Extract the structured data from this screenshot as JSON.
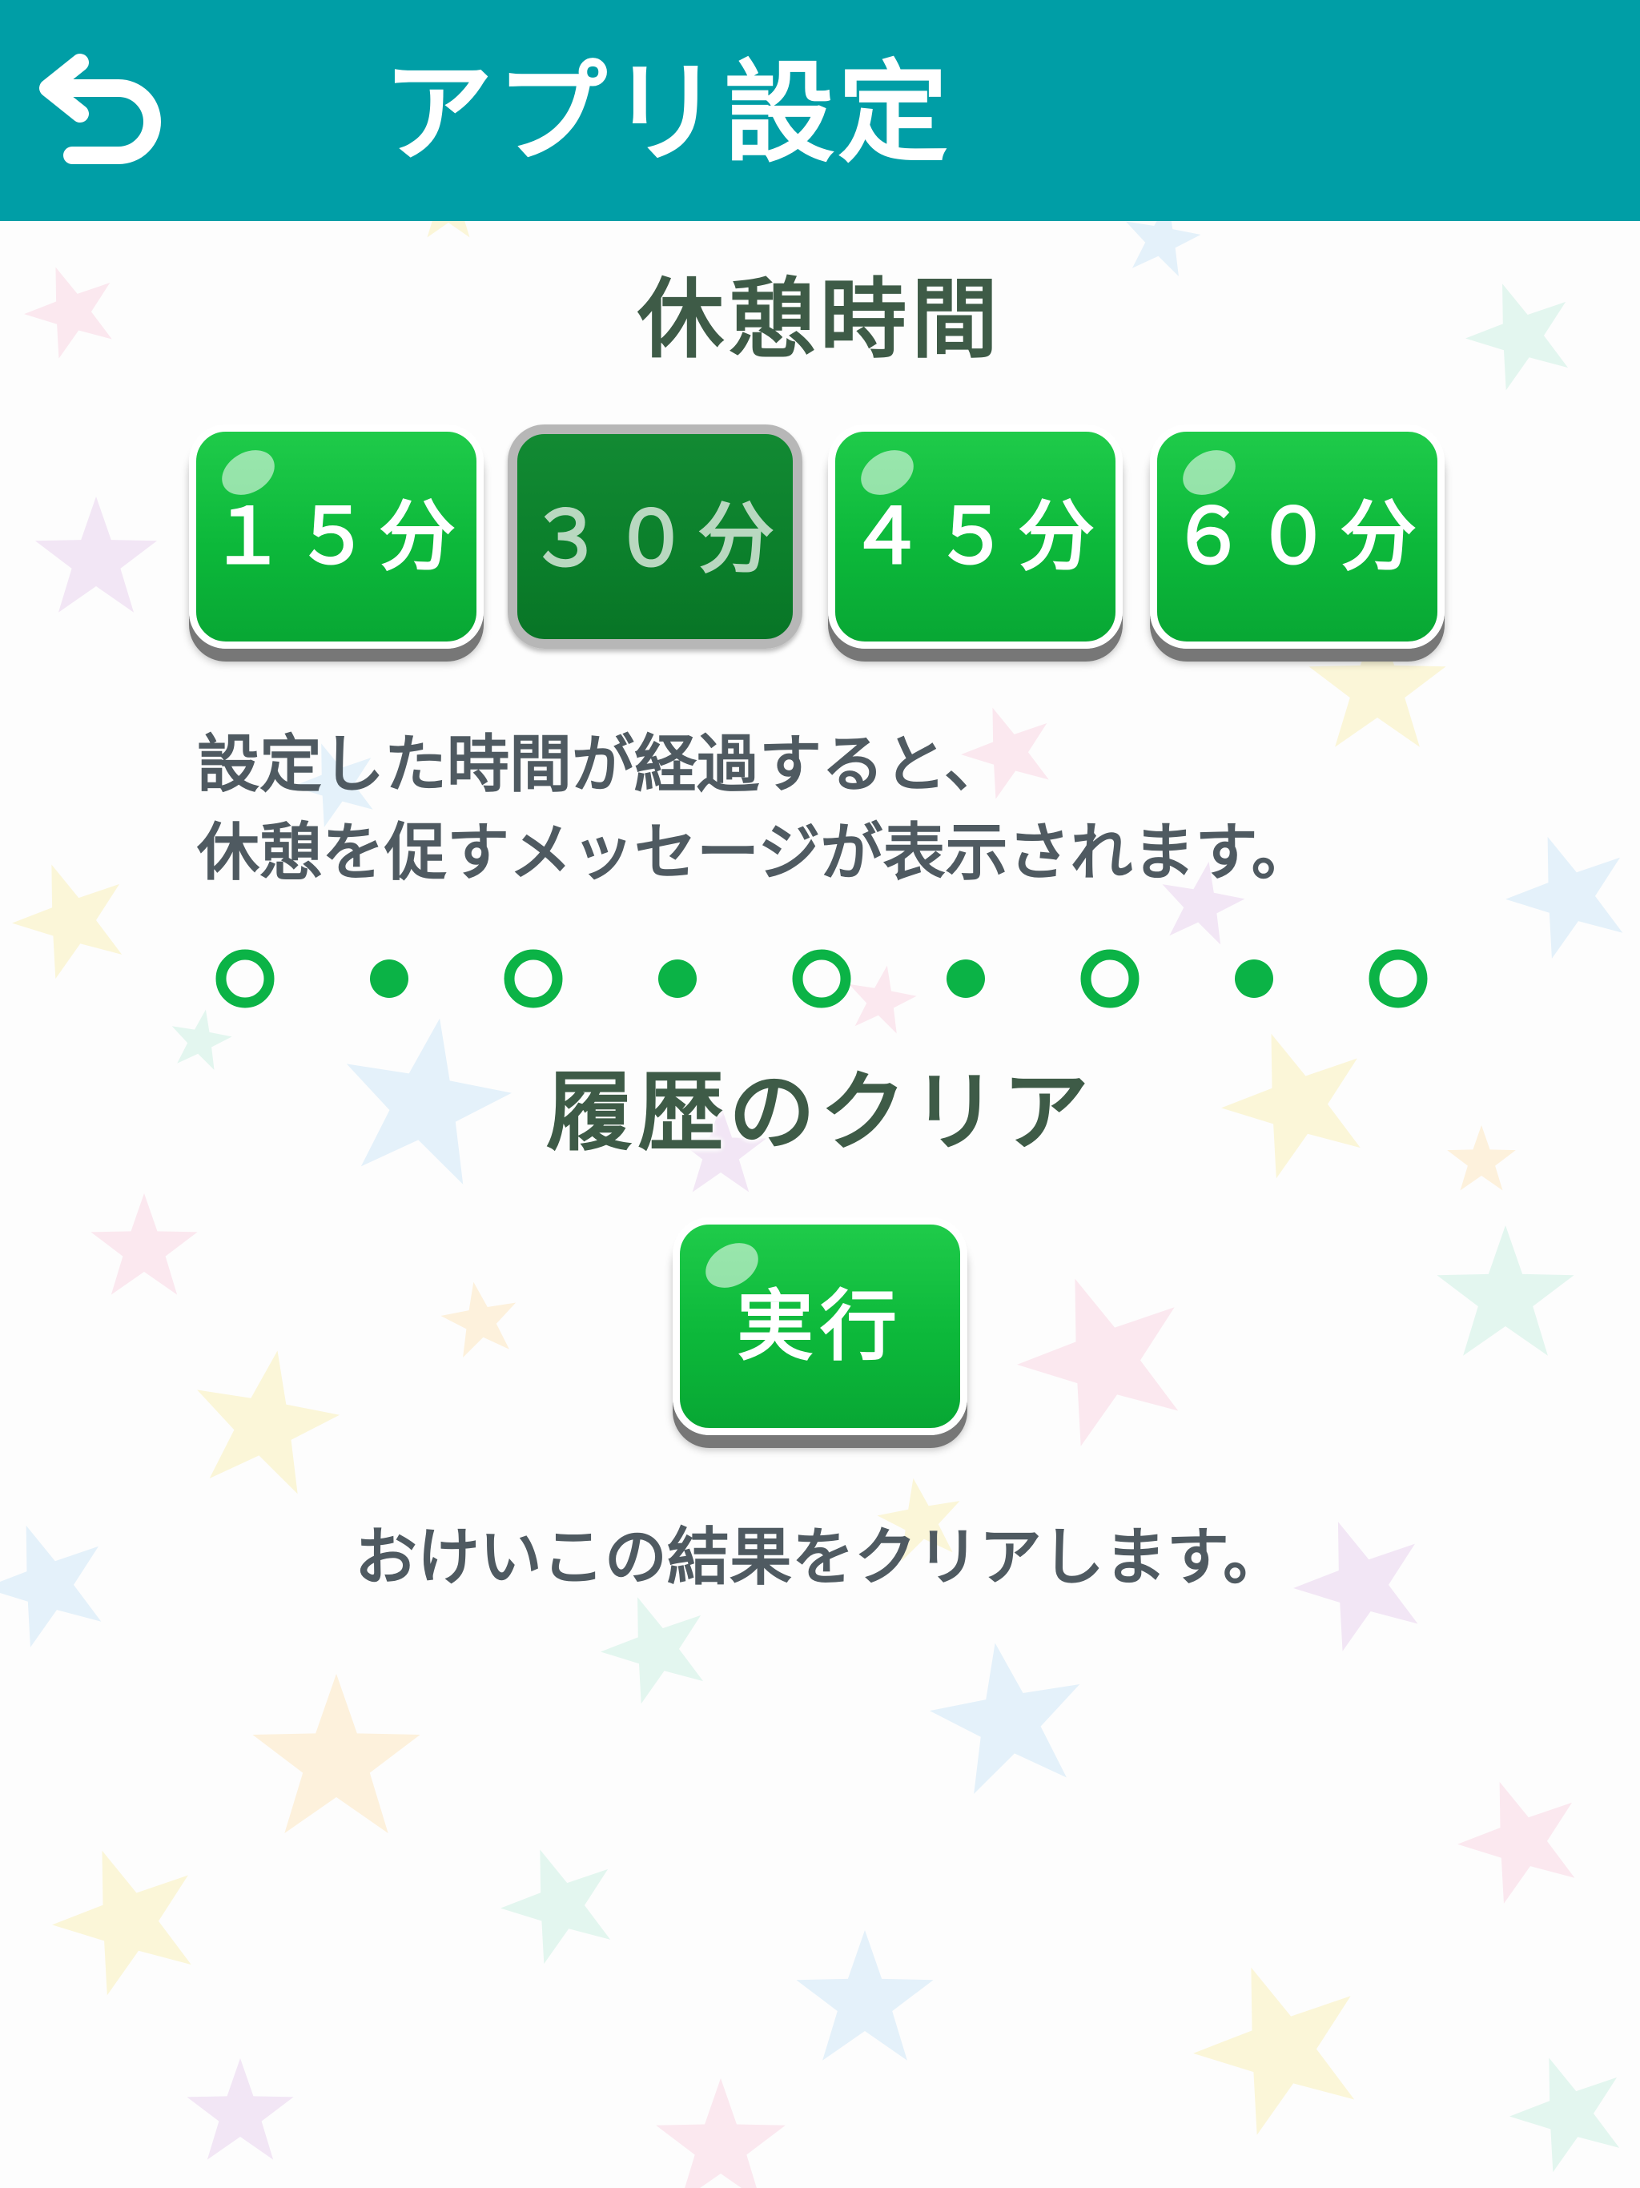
{
  "header": {
    "title": "アプリ設定",
    "back_icon": "back-arrow-icon",
    "background_color": "#009ea6"
  },
  "break_time": {
    "title": "休憩時間",
    "options": [
      "１５分",
      "３０分",
      "４５分",
      "６０分"
    ],
    "selected": "３０分",
    "description_line1": "設定した時間が経過すると、",
    "description_line2": "休憩を促すメッセージが表示されます。"
  },
  "history": {
    "title": "履歴のクリア",
    "execute_label": "実行",
    "description": "おけいこの結果をクリアします。"
  },
  "colors": {
    "button_green": "#0cb83a",
    "selected_green": "#0b7f2b",
    "divider_green": "#0bb346",
    "title_text": "#3e5b47",
    "body_text": "#4f5a61"
  }
}
